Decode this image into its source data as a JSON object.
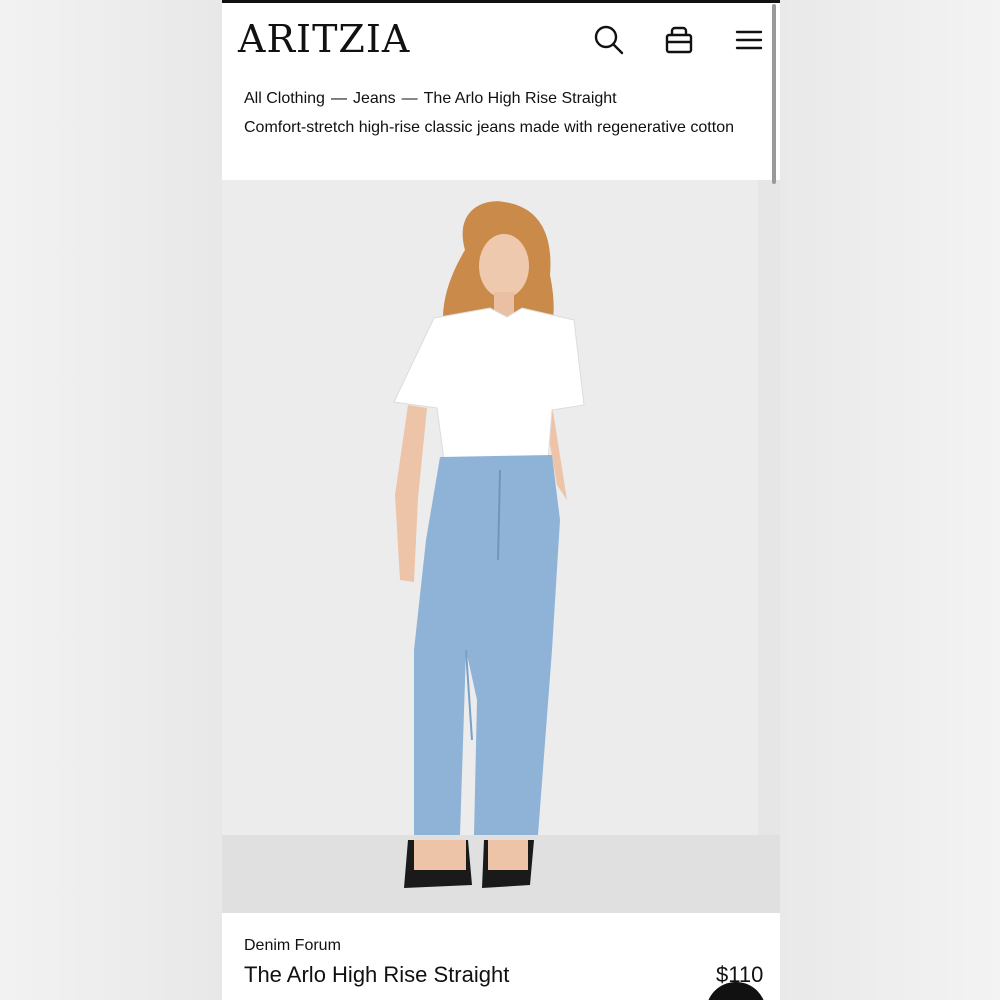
{
  "header": {
    "logo": "ARITZIA",
    "icons": [
      "search-icon",
      "shopping-bag-icon",
      "menu-icon"
    ]
  },
  "breadcrumb": {
    "items": [
      "All Clothing",
      "Jeans",
      "The Arlo High Rise Straight"
    ],
    "separator": "—"
  },
  "product": {
    "description": "Comfort-stretch high-rise classic jeans made with regenerative cotton",
    "brand": "Denim Forum",
    "name": "The Arlo High Rise Straight",
    "price": "$110"
  },
  "colors": {
    "text": "#111111",
    "background": "#ffffff",
    "photo_bg": "#ececec",
    "denim": "#8fb3d6",
    "shirt": "#ffffff",
    "hair": "#c98a4a"
  }
}
